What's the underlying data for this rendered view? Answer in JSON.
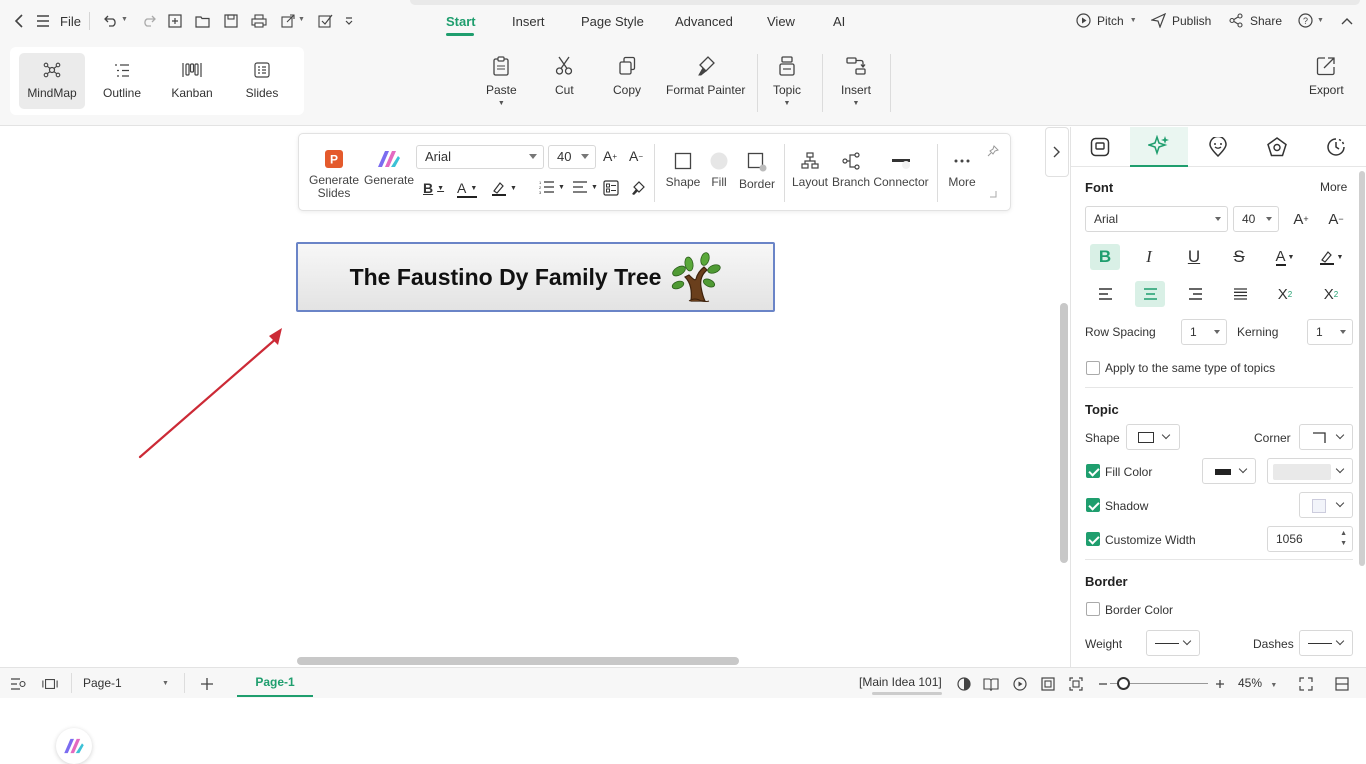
{
  "topbar": {
    "file_label": "File",
    "menu_tabs": [
      "Start",
      "Insert",
      "Page Style",
      "Advanced",
      "View",
      "AI"
    ],
    "active_tab": "Start",
    "pitch_label": "Pitch",
    "publish_label": "Publish",
    "share_label": "Share"
  },
  "ribbon": {
    "views": [
      "MindMap",
      "Outline",
      "Kanban",
      "Slides"
    ],
    "paste": "Paste",
    "cut": "Cut",
    "copy": "Copy",
    "format_painter": "Format Painter",
    "topic": "Topic",
    "insert": "Insert",
    "export": "Export"
  },
  "floating_toolbar": {
    "generate_slides": "Generate Slides",
    "generate": "Generate",
    "font": "Arial",
    "size": "40",
    "shape": "Shape",
    "fill": "Fill",
    "border": "Border",
    "layout": "Layout",
    "branch": "Branch",
    "connector": "Connector",
    "more": "More"
  },
  "canvas": {
    "topic_text": "The Faustino Dy Family Tree",
    "arrow_color": "#cc2a36"
  },
  "panel": {
    "font_title": "Font",
    "more": "More",
    "font_family": "Arial",
    "font_size": "40",
    "row_spacing_label": "Row Spacing",
    "row_spacing": "1",
    "kerning_label": "Kerning",
    "kerning": "1",
    "apply_same": "Apply to the same type of topics",
    "topic_title": "Topic",
    "shape_label": "Shape",
    "corner_label": "Corner",
    "fill_color_label": "Fill Color",
    "shadow_label": "Shadow",
    "customize_width_label": "Customize Width",
    "width_value": "1056",
    "border_title": "Border",
    "border_color_label": "Border Color",
    "weight_label": "Weight",
    "dashes_label": "Dashes",
    "accent": "#1f9e6e"
  },
  "statusbar": {
    "page_select": "Page-1",
    "page_tab": "Page-1",
    "main_idea": "[Main Idea 101]",
    "zoom": "45%"
  }
}
